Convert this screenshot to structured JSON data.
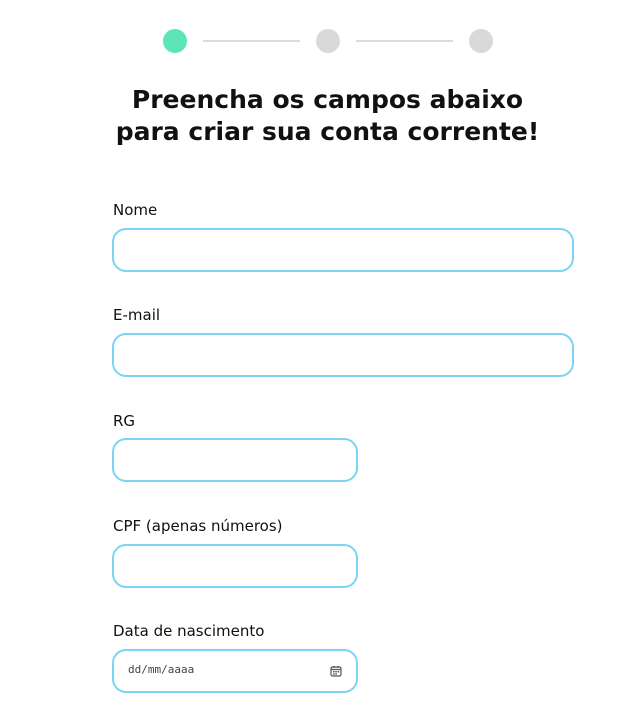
{
  "stepper": {
    "total_steps": 3,
    "current_step": 1,
    "active_color": "#5ce6b6",
    "inactive_color": "#d9d9d9"
  },
  "title": {
    "line1": "Preencha os campos abaixo",
    "line2": "para criar sua conta corrente!"
  },
  "form": {
    "accent_color": "#7bd3f5",
    "nome": {
      "label": "Nome",
      "value": ""
    },
    "email": {
      "label": "E-mail",
      "value": ""
    },
    "rg": {
      "label": "RG",
      "value": ""
    },
    "cpf": {
      "label": "CPF (apenas números)",
      "value": ""
    },
    "nascimento": {
      "label": "Data de nascimento",
      "value": "",
      "placeholder": "dd/mm/aaaa",
      "icon": "calendar-icon"
    }
  }
}
